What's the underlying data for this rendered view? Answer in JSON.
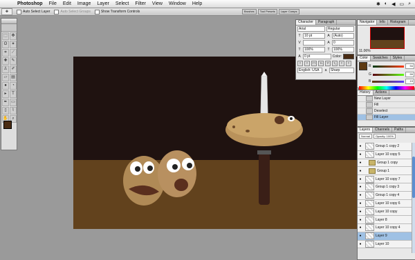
{
  "menubar": {
    "app": "Photoshop",
    "items": [
      "File",
      "Edit",
      "Image",
      "Layer",
      "Select",
      "Filter",
      "View",
      "Window",
      "Help"
    ]
  },
  "options": {
    "auto_select_layer": "Auto Select Layer",
    "auto_select_groups": "Auto Select Groups",
    "show_transform": "Show Transform Controls"
  },
  "dock_tabs": [
    "Brushes",
    "Tool Presets",
    "Layer Comps"
  ],
  "character": {
    "tabs": [
      "Character",
      "Paragraph"
    ],
    "font_family": "Arial",
    "font_style": "Regular",
    "size": "10 pt",
    "leading": "(Auto)",
    "tracking": "0",
    "vscale": "100%",
    "hscale": "100%",
    "baseline": "0 pt",
    "color_label": "Color:",
    "language": "English: USA",
    "aa": "Sharp"
  },
  "navigator": {
    "tabs": [
      "Navigator",
      "Info",
      "Histogram"
    ],
    "zoom": "11.06%"
  },
  "color": {
    "tabs": [
      "Color",
      "Swatches",
      "Styles"
    ],
    "r": "94",
    "g": "59",
    "b": "19",
    "swatch": "#5e3b13"
  },
  "history": {
    "tabs": [
      "History",
      "Actions"
    ],
    "items": [
      "New Layer",
      "Fill",
      "Deselect",
      "Fill Layer"
    ],
    "selected": 3
  },
  "layers": {
    "tabs": [
      "Layers",
      "Channels",
      "Paths"
    ],
    "mode": "Normal",
    "opacity": "Opacity: 100%",
    "items": [
      {
        "name": "Group 1 copy 2",
        "kind": "layer"
      },
      {
        "name": "Layer 10 copy 5",
        "kind": "layer"
      },
      {
        "name": "Group 1 copy",
        "kind": "group"
      },
      {
        "name": "Group 1",
        "kind": "group"
      },
      {
        "name": "Layer 10 copy 7",
        "kind": "layer"
      },
      {
        "name": "Group 1 copy 3",
        "kind": "layer"
      },
      {
        "name": "Group 1 copy 4",
        "kind": "layer"
      },
      {
        "name": "Layer 10 copy 6",
        "kind": "layer"
      },
      {
        "name": "Layer 10 copy",
        "kind": "layer"
      },
      {
        "name": "Layer 8",
        "kind": "layer"
      },
      {
        "name": "Layer 10 copy 4",
        "kind": "layer"
      },
      {
        "name": "Layer 9",
        "kind": "layer"
      },
      {
        "name": "Layer 10",
        "kind": "layer"
      }
    ],
    "selected": 11
  },
  "colors": {
    "fg": "#4a2c14",
    "bg": "#ffffff"
  }
}
